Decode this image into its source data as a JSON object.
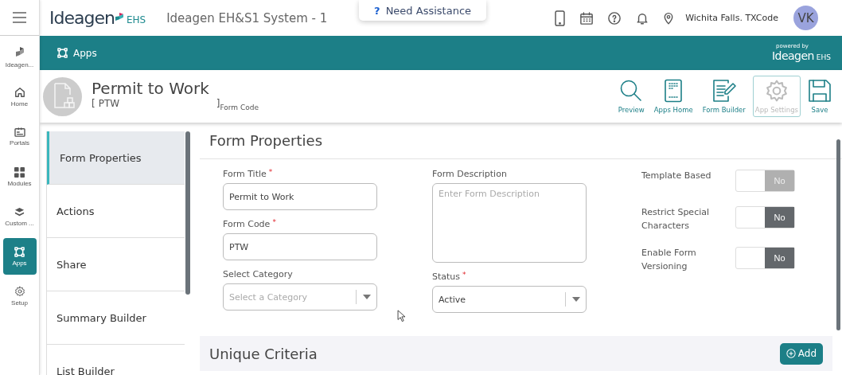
{
  "header": {
    "logo": {
      "word": "Ideagen",
      "suffix": "EHS"
    },
    "system_title": "Ideagen EH&S1 System - 1",
    "assistance": {
      "icon": "?",
      "label": "Need Assistance"
    },
    "location": "Wichita Falls. TXCode",
    "avatar": "VK"
  },
  "rail": [
    {
      "label": "Ideagen...",
      "selected": false
    },
    {
      "label": "Home",
      "selected": false
    },
    {
      "label": "Portals",
      "selected": false
    },
    {
      "label": "Modules",
      "selected": false
    },
    {
      "label": "Custom ...",
      "selected": false
    },
    {
      "label": "Apps",
      "selected": true
    },
    {
      "label": "Setup",
      "selected": false
    }
  ],
  "breadcrumb": {
    "label": "Apps",
    "powered_by": "powered by",
    "brand": "Ideagen",
    "brand_suffix": "EHS"
  },
  "page": {
    "title": "Permit to Work",
    "open_bracket": "[",
    "code": "PTW",
    "close_bracket": "]",
    "code_caption": "Form Code"
  },
  "actions": [
    {
      "label": "Preview",
      "disabled": false
    },
    {
      "label": "Apps Home",
      "disabled": false
    },
    {
      "label": "Form Builder",
      "disabled": false
    },
    {
      "label": "App Settings",
      "disabled": true
    },
    {
      "label": "Save",
      "disabled": false
    }
  ],
  "tabs": [
    {
      "label": "Form Properties",
      "selected": true
    },
    {
      "label": "Actions",
      "selected": false
    },
    {
      "label": "Share",
      "selected": false
    },
    {
      "label": "Summary Builder",
      "selected": false
    },
    {
      "label": "List Builder",
      "selected": false
    }
  ],
  "section": {
    "title": "Form Properties",
    "fields": [
      {
        "kind": "text",
        "label": "Form Title",
        "required_mark": "*",
        "value": "Permit to Work"
      },
      {
        "kind": "textarea",
        "label": "Form Description",
        "placeholder": "Enter Form Description"
      },
      {
        "kind": "text",
        "label": "Form Code",
        "required_mark": "*",
        "value": "PTW"
      },
      {
        "kind": "select",
        "label": "Select Category",
        "placeholder": "Select a Category"
      },
      {
        "kind": "select",
        "label": "Status",
        "required_mark": "*",
        "value": "Active"
      }
    ],
    "toggles": [
      {
        "label": "Template Based",
        "text": "No",
        "on": false,
        "disabled": true
      },
      {
        "label": "Restrict Special Characters",
        "text": "No",
        "on": false,
        "disabled": false
      },
      {
        "label": "Enable Form Versioning",
        "text": "No",
        "on": false,
        "disabled": false
      }
    ]
  },
  "unique_criteria": {
    "title": "Unique Criteria",
    "button": "Add"
  }
}
